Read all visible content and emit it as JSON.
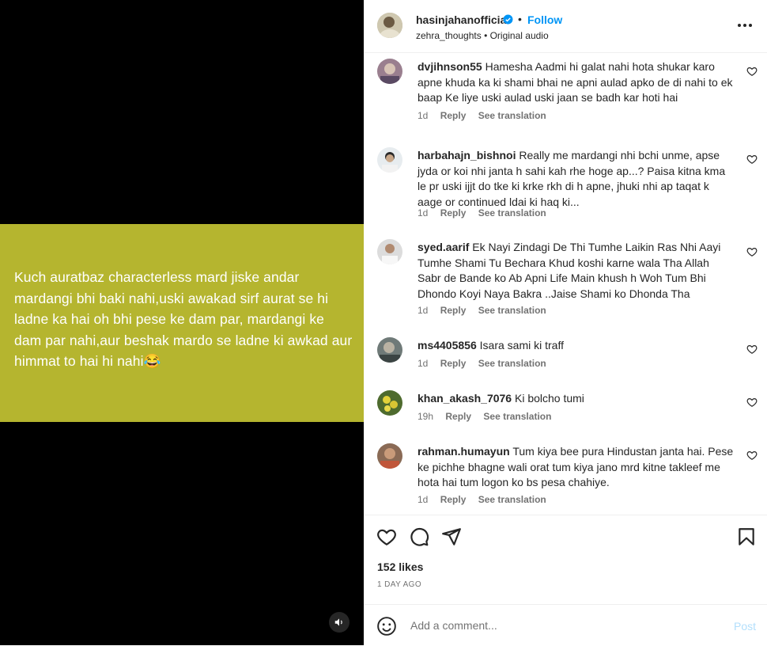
{
  "media": {
    "caption_text": "Kuch auratbaz characterless mard jiske andar mardangi bhi baki nahi,uski awakad sirf aurat se hi ladne ka hai oh bhi pese ke dam par, mardangi ke dam par nahi,aur beshak mardo se ladne ki awkad aur himmat to hai hi nahi😂",
    "card_color": "#b5b52f",
    "audio_icon": "speaker-icon"
  },
  "header": {
    "username": "hasinjahanofficial",
    "separator": "•",
    "follow_label": "Follow",
    "subtitle": "zehra_thoughts • Original audio"
  },
  "comments": [
    {
      "username": "dvjihnson55",
      "text": "Hamesha Aadmi hi galat nahi hota shukar karo apne khuda ka ki shami bhai ne apni aulad apko de di nahi to ek baap Ke liye uski aulad uski jaan se badh kar hoti hai",
      "time": "1d",
      "reply": "Reply",
      "translate": "See translation"
    },
    {
      "username": "harbahajn_bishnoi",
      "text": "Really me mardangi nhi bchi unme, apse jyda or koi nhi janta h sahi kah rhe hoge ap...? Paisa kitna kma le pr uski ijjt do tke ki krke rkh di h apne, jhuki nhi ap taqat k aage or continued ldai ki haq ki...",
      "time": "1d",
      "reply": "Reply",
      "translate": "See translation"
    },
    {
      "username": "syed.aarif",
      "text": "Ek Nayi Zindagi De Thi Tumhe Laikin Ras Nhi Aayi Tumhe Shami Tu Bechara Khud koshi karne wala Tha Allah Sabr de Bande ko Ab Apni Life Main khush h Woh Tum Bhi Dhondo Koyi Naya Bakra ..Jaise Shami ko Dhonda Tha",
      "time": "1d",
      "reply": "Reply",
      "translate": "See translation"
    },
    {
      "username": "ms4405856",
      "text": "Isara sami ki traff",
      "time": "1d",
      "reply": "Reply",
      "translate": "See translation"
    },
    {
      "username": "khan_akash_7076",
      "text": "Ki bolcho tumi",
      "time": "19h",
      "reply": "Reply",
      "translate": "See translation"
    },
    {
      "username": "rahman.humayun",
      "text": "Tum kiya bee pura Hindustan janta hai. Pese ke pichhe bhagne wali orat tum kiya jano mrd kitne takleef me hota hai tum logon ko bs pesa chahiye.",
      "time": "1d",
      "reply": "Reply",
      "translate": "See translation"
    }
  ],
  "footer": {
    "likes": "152 likes",
    "time": "1 DAY AGO",
    "comment_placeholder": "Add a comment...",
    "post_label": "Post"
  },
  "colors": {
    "accent": "#0095f6",
    "post_disabled": "#b2dffc",
    "muted": "#737373"
  }
}
